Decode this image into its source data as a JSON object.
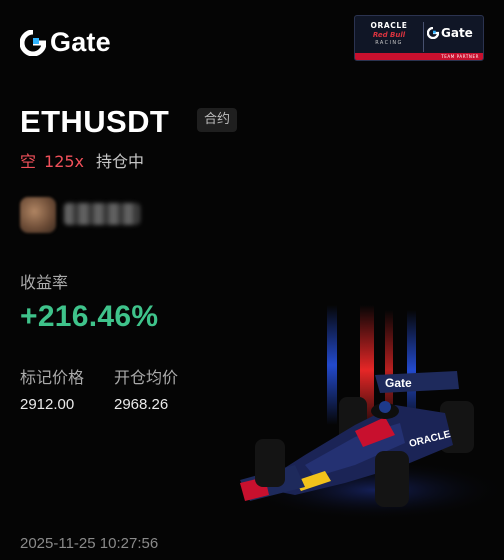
{
  "brand": {
    "name": "Gate",
    "icon": "gate-logo-icon"
  },
  "sponsor": {
    "line1": "ORACLE",
    "line2": "Red Bull",
    "line3": "RACING",
    "partner_name": "Gate",
    "strip": "TEAM PARTNER"
  },
  "position": {
    "pair": "ETHUSDT",
    "type_tag": "合约",
    "side": "空",
    "leverage": "125x",
    "status": "持仓中"
  },
  "user": {
    "avatar": "blurred-avatar",
    "name": "blurred"
  },
  "yield": {
    "label": "收益率",
    "value": "+216.46%"
  },
  "prices": {
    "mark_label": "标记价格",
    "mark_value": "2912.00",
    "open_label": "开仓均价",
    "open_value": "2968.26"
  },
  "timestamp": "2025-11-25 10:27:56",
  "colors": {
    "background": "#050505",
    "profit": "#3fc38b",
    "short": "#f0505a",
    "brand_blue": "#2354e6"
  }
}
